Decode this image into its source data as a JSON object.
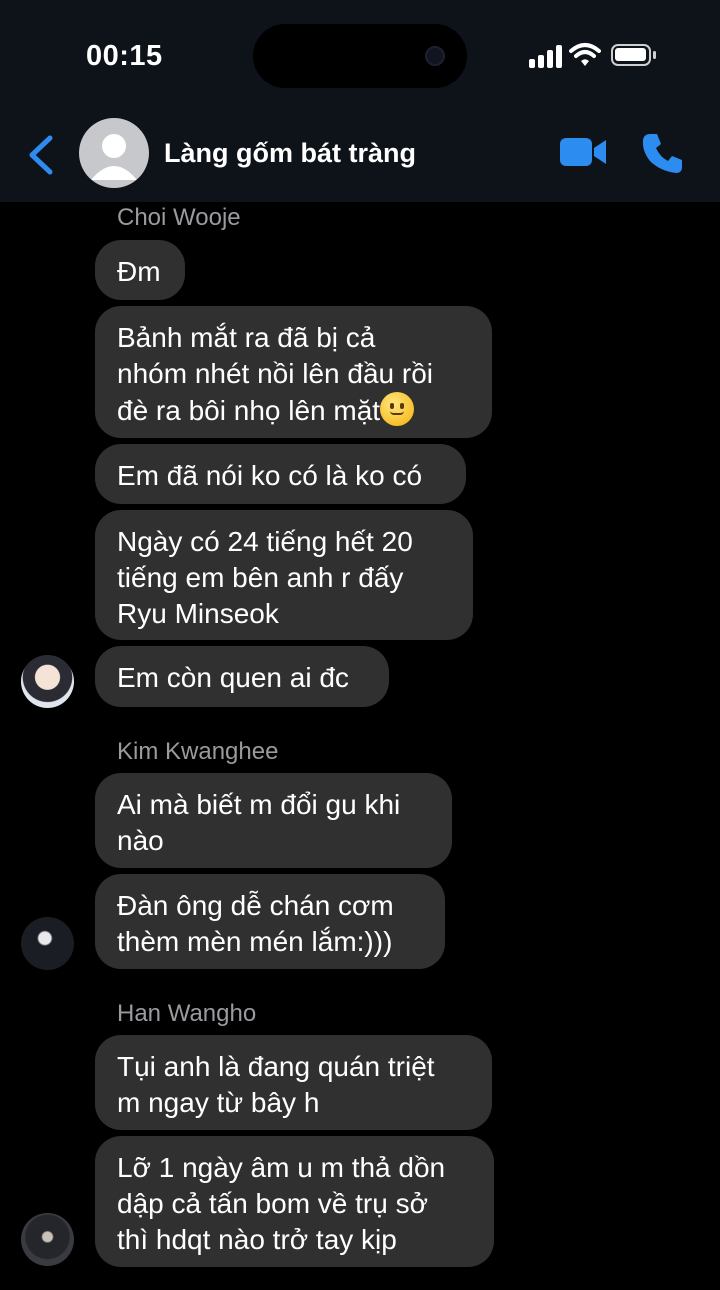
{
  "status_bar": {
    "time": "00:15"
  },
  "header": {
    "group_name": "Làng gốm bát tràng"
  },
  "colors": {
    "accent": "#2d8cf0",
    "bubble": "#303030",
    "header_bg": "#0e131a"
  },
  "icons": [
    "back-chevron-icon",
    "video-call-icon",
    "phone-call-icon",
    "signal-icon",
    "wifi-icon",
    "battery-icon"
  ],
  "messages": [
    {
      "sender": "Choi Wooje",
      "bubbles": [
        "Đm",
        "Bảnh mắt ra đã bị cả\nnhóm nhét nồi lên đầu rồi\nđè ra bôi nhọ lên mặt",
        "Em đã nói ko có là ko có",
        "Ngày có 24 tiếng hết 20\ntiếng em bên anh r đấy\nRyu Minseok",
        "Em còn quen ai đc"
      ]
    },
    {
      "sender": "Kim Kwanghee",
      "bubbles": [
        "Ai mà biết m đổi gu khi\nnào",
        "Đàn ông dễ chán cơm\nthèm mèn mén lắm:)))"
      ]
    },
    {
      "sender": "Han Wangho",
      "bubbles": [
        "Tụi anh là đang quán triệt\nm ngay từ bây h",
        "Lỡ 1 ngày âm u m thả dồn\ndập cả tấn bom về trụ sở\nthì hdqt nào trở tay kịp"
      ]
    }
  ]
}
